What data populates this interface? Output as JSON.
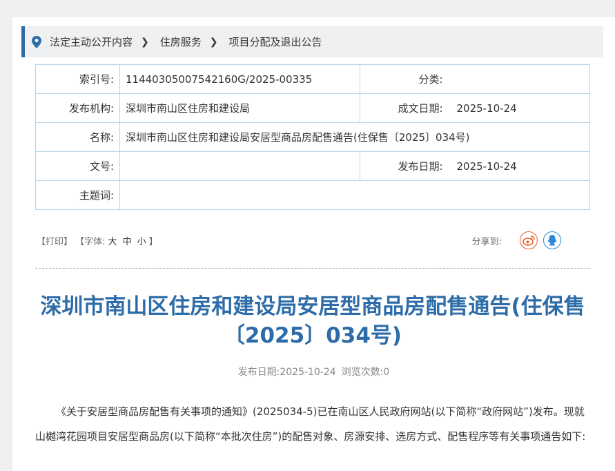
{
  "breadcrumb": {
    "items": [
      "法定主动公开内容",
      "住房服务",
      "项目分配及退出公告"
    ]
  },
  "meta": {
    "index_label": "索引号:",
    "index_value": "11440305007542160G/2025-00335",
    "category_label": "分类:",
    "category_value": "",
    "publisher_label": "发布机构:",
    "publisher_value": "深圳市南山区住房和建设局",
    "written_date_label": "成文日期:",
    "written_date_value": "2025-10-24",
    "name_label": "名称:",
    "name_value": "深圳市南山区住房和建设局安居型商品房配售通告(住保售〔2025〕034号)",
    "doc_no_label": "文号:",
    "doc_no_value": "",
    "publish_date_label": "发布日期:",
    "publish_date_value": "2025-10-24",
    "keywords_label": "主题词:",
    "keywords_value": ""
  },
  "toolbar": {
    "print": "【打印】",
    "font_prefix": "【字体:",
    "font_large": "大",
    "font_medium": "中",
    "font_small": "小",
    "font_suffix": "】",
    "share_label": "分享到:"
  },
  "article": {
    "title": "深圳市南山区住房和建设局安居型商品房配售通告(住保售〔2025〕034号)",
    "publish_info": "发布日期:2025-10-24",
    "views_info": "浏览次数:0",
    "paragraph": "《关于安居型商品房配售有关事项的通知》(2025034-5)已在南山区人民政府网站(以下简称“政府网站”)发布。现就山樾湾花园项目安居型商品房(以下简称“本批次住房”)的配售对象、房源安排、选房方式、配售程序等有关事项通告如下:"
  },
  "colors": {
    "accent": "#2d6ca8",
    "table_border": "#b9d3e6",
    "weibo": "#e8602c",
    "qq": "#2b8ad8"
  }
}
